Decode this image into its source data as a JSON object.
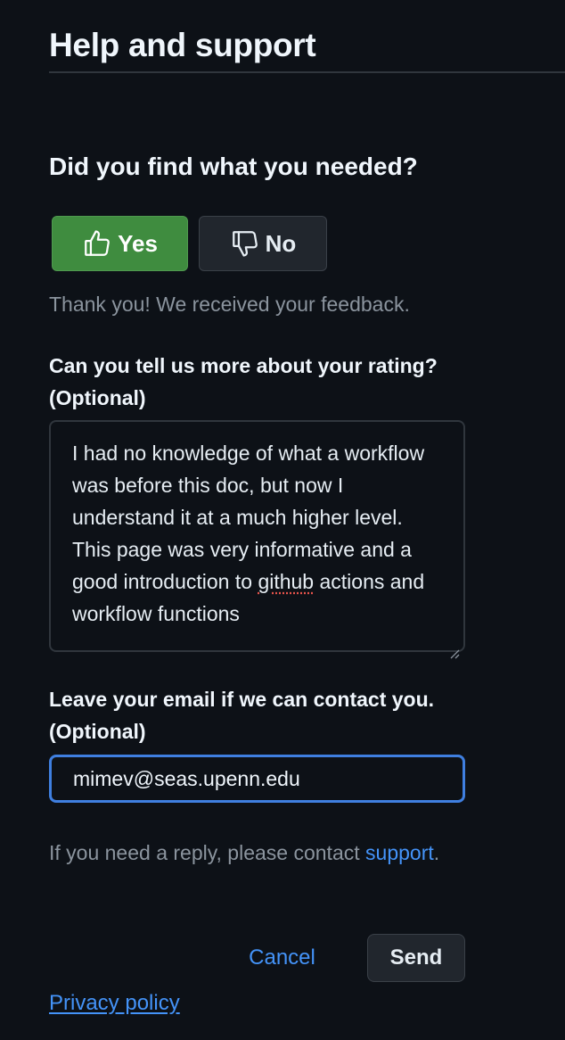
{
  "header": {
    "title": "Help and support"
  },
  "feedback": {
    "question": "Did you find what you needed?",
    "yes_label": "Yes",
    "no_label": "No",
    "thanks_message": "Thank you! We received your feedback.",
    "yes_icon": "thumbs-up-icon",
    "no_icon": "thumbs-down-icon"
  },
  "rating_comment": {
    "label_line1": "Can you tell us more about your rating?",
    "label_line2": "(Optional)",
    "value_part1": "I had no knowledge of what a workflow was before this doc, but now I understand it at a much higher level. This page was very informative and a good introduction to ",
    "value_misspelled": "github",
    "value_part2": " actions and workflow functions"
  },
  "email": {
    "label_line1": "Leave your email if we can contact you.",
    "label_line2": "(Optional)",
    "value": "mimev@seas.upenn.edu"
  },
  "reply_note": {
    "text": "If you need a reply, please contact ",
    "link_text": "support",
    "suffix": "."
  },
  "actions": {
    "cancel_label": "Cancel",
    "send_label": "Send"
  },
  "footer": {
    "privacy_label": "Privacy policy"
  },
  "colors": {
    "background": "#0d1117",
    "yes_button": "#3f8c3f",
    "link": "#4493f8",
    "focus_border": "#3f7fe0"
  }
}
